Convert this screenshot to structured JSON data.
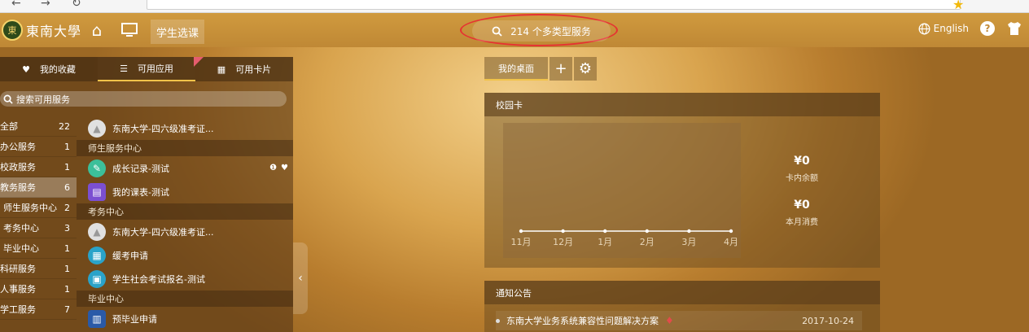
{
  "header": {
    "logo_text": "東南大學",
    "logo_seal": "東",
    "active_tab": "学生选课",
    "search_text": "214 个多类型服务",
    "lang_label": "English",
    "help_icon": "?"
  },
  "left_tabs": [
    {
      "label": "我的收藏",
      "icon": "♥"
    },
    {
      "label": "可用应用",
      "icon": "☰"
    },
    {
      "label": "可用卡片",
      "icon": "▦"
    }
  ],
  "service_search_placeholder": "搜索可用服务",
  "categories": [
    {
      "name": "全部",
      "count": "22"
    },
    {
      "name": "办公服务",
      "count": "1"
    },
    {
      "name": "校政服务",
      "count": "1"
    },
    {
      "name": "教务服务",
      "count": "6"
    },
    {
      "name": "师生服务中心",
      "count": "2"
    },
    {
      "name": "考务中心",
      "count": "3"
    },
    {
      "name": "毕业中心",
      "count": "1"
    },
    {
      "name": "科研服务",
      "count": "1"
    },
    {
      "name": "人事服务",
      "count": "1"
    },
    {
      "name": "学工服务",
      "count": "7"
    }
  ],
  "services": [
    {
      "type": "item",
      "name": "东南大学-四六级准考证...",
      "color": "#e0e0e0"
    },
    {
      "type": "group",
      "name": "师生服务中心"
    },
    {
      "type": "item",
      "name": "成长记录-测试",
      "color": "#3cbf9a"
    },
    {
      "type": "item",
      "name": "我的课表-测试",
      "color": "#7b4fd1"
    },
    {
      "type": "group",
      "name": "考务中心"
    },
    {
      "type": "item",
      "name": "东南大学-四六级准考证...",
      "color": "#e0e0e0"
    },
    {
      "type": "item",
      "name": "缓考申请",
      "color": "#2aa3c9"
    },
    {
      "type": "item",
      "name": "学生社会考试报名-测试",
      "color": "#2aa3c9"
    },
    {
      "type": "group",
      "name": "毕业中心"
    },
    {
      "type": "item",
      "name": "预毕业申请",
      "color": "#2aa3c9"
    }
  ],
  "desktop": {
    "tab_label": "我的桌面",
    "add_label": "+",
    "settings_icon": "⚙"
  },
  "campus_card": {
    "title": "校园卡",
    "balance_value": "¥0",
    "balance_label": "卡内余额",
    "month_value": "¥0",
    "month_label": "本月消费"
  },
  "chart_data": {
    "type": "line",
    "categories": [
      "11月",
      "12月",
      "1月",
      "2月",
      "3月",
      "4月"
    ],
    "values": [
      0,
      0,
      0,
      0,
      0,
      0
    ]
  },
  "notice": {
    "title": "通知公告",
    "items": [
      {
        "text": "东南大学业务系统兼容性问题解决方案",
        "date": "2017-10-24"
      }
    ]
  }
}
